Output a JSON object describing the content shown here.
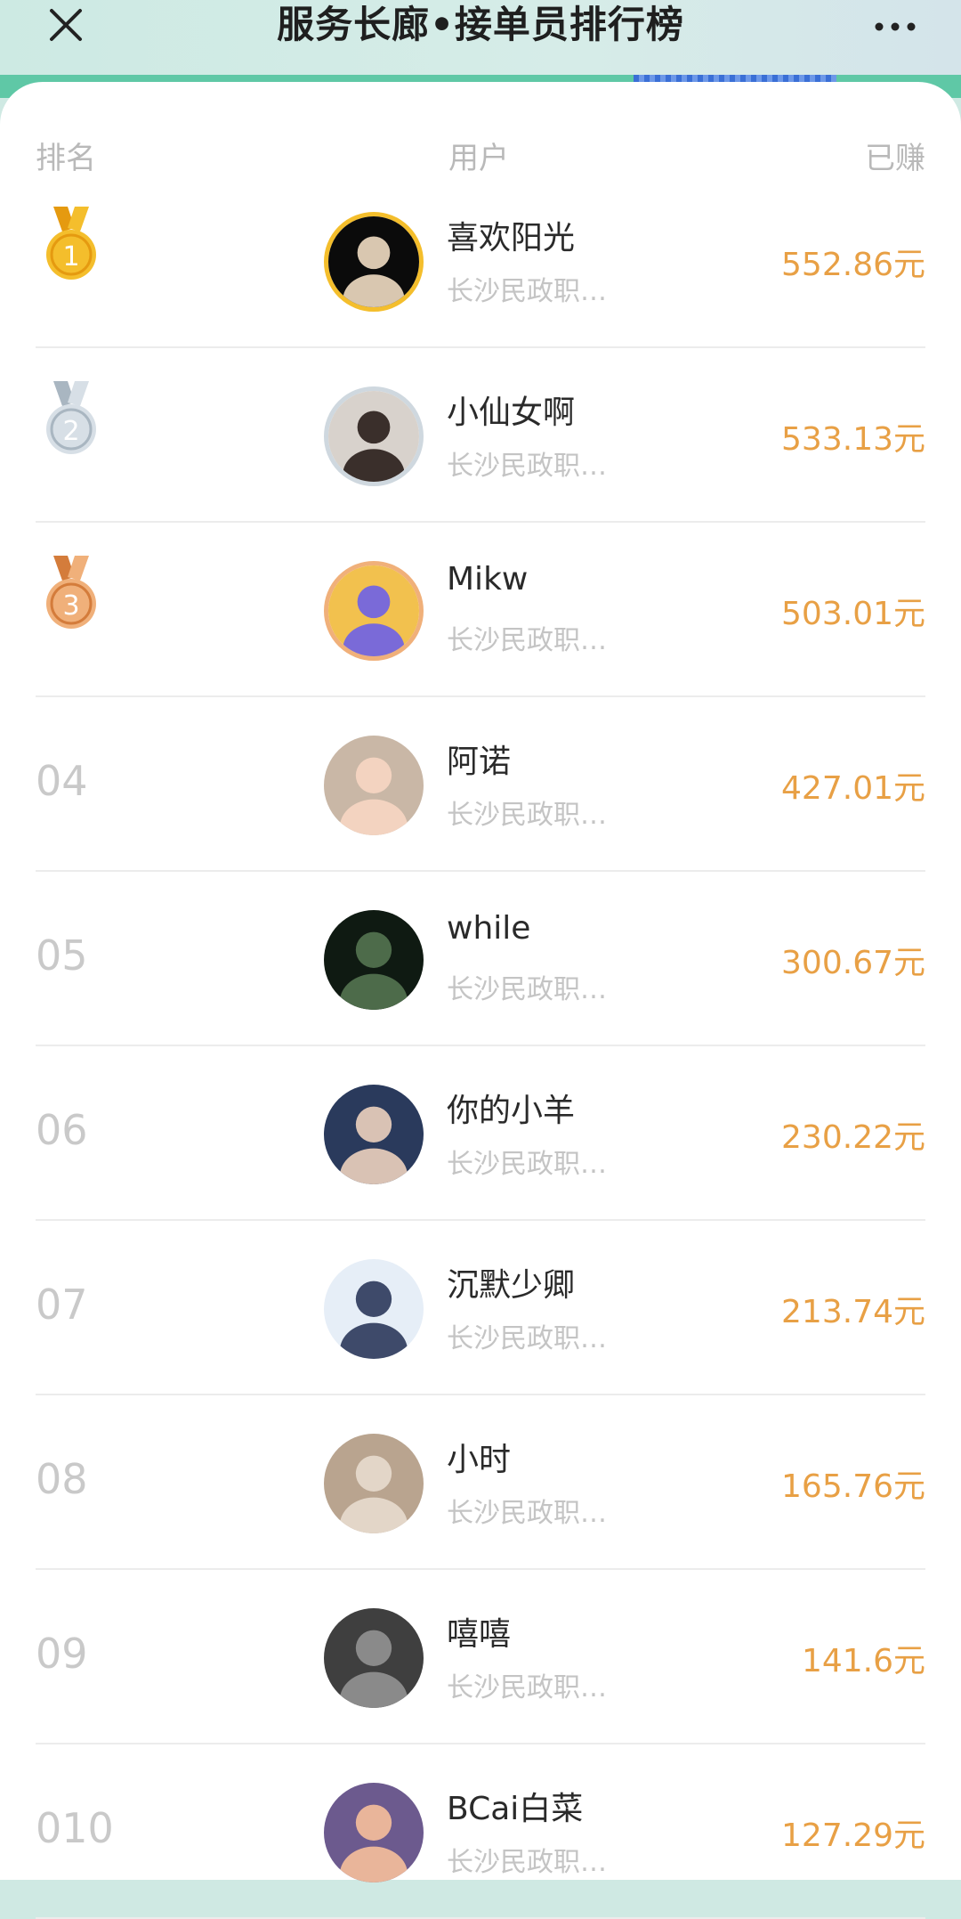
{
  "header": {
    "title": "服务长廊•接单员排行榜",
    "close_icon": "close-icon",
    "more_icon": "more-icon"
  },
  "columns": {
    "rank": "排名",
    "user": "用户",
    "earned": "已赚"
  },
  "colors": {
    "earned": "#e8a045",
    "gold": "#f4be2c",
    "silver": "#cfd8df",
    "bronze": "#f0b07a"
  },
  "rows": [
    {
      "rank": "1",
      "name": "喜欢阳光",
      "sub": "长沙民政职…",
      "earned": "552.86元",
      "medal": "gold"
    },
    {
      "rank": "2",
      "name": "小仙女啊",
      "sub": "长沙民政职…",
      "earned": "533.13元",
      "medal": "silver"
    },
    {
      "rank": "3",
      "name": "Mikw",
      "sub": "长沙民政职…",
      "earned": "503.01元",
      "medal": "bronze"
    },
    {
      "rank": "04",
      "name": "阿诺",
      "sub": "长沙民政职…",
      "earned": "427.01元"
    },
    {
      "rank": "05",
      "name": "while",
      "sub": "长沙民政职…",
      "earned": "300.67元"
    },
    {
      "rank": "06",
      "name": "你的小羊",
      "sub": "长沙民政职…",
      "earned": "230.22元"
    },
    {
      "rank": "07",
      "name": "沉默少卿",
      "sub": "长沙民政职…",
      "earned": "213.74元"
    },
    {
      "rank": "08",
      "name": "小时",
      "sub": "长沙民政职…",
      "earned": "165.76元"
    },
    {
      "rank": "09",
      "name": "嘻嘻",
      "sub": "长沙民政职…",
      "earned": "141.6元"
    },
    {
      "rank": "010",
      "name": "BCai白菜",
      "sub": "长沙民政职…",
      "earned": "127.29元"
    }
  ]
}
